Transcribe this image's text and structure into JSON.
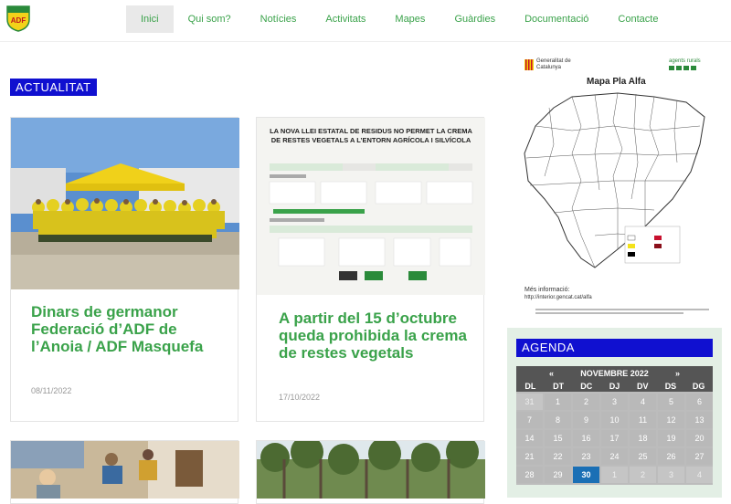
{
  "nav": {
    "items": [
      "Inici",
      "Qui som?",
      "Notícies",
      "Activitats",
      "Mapes",
      "Guàrdies",
      "Documentació",
      "Contacte"
    ],
    "active_index": 0
  },
  "logo": {
    "text": "ADF"
  },
  "section_label": "ACTUALITAT",
  "cards": [
    {
      "title": "Dinars de germanor Federació d’ADF de l’Anoia / ADF Masquefa",
      "date": "08/11/2022"
    },
    {
      "title": "A partir del 15 d’octubre queda prohibida la crema de restes vegetals",
      "date": "17/10/2022"
    }
  ],
  "notice": {
    "heading": "LA NOVA LLEI ESTATAL DE RESIDUS NO PERMET LA CREMA DE RESTES VEGETALS A L’ENTORN AGRÍCOLA I SILVÍCOLA"
  },
  "map": {
    "title": "Mapa Pla Alfa",
    "org_left": "Generalitat de Catalunya",
    "org_right": "agents rurals",
    "more_info": "Més informació:",
    "url": "http://interior.gencat.cat/alfa"
  },
  "agenda": {
    "label": "AGENDA",
    "prev": "«",
    "month": "NOVEMBRE 2022",
    "next": "»",
    "weekdays": [
      "DL",
      "DT",
      "DC",
      "DJ",
      "DV",
      "DS",
      "DG"
    ],
    "days": [
      "31",
      "1",
      "2",
      "3",
      "4",
      "5",
      "6",
      "7",
      "8",
      "9",
      "10",
      "11",
      "12",
      "13",
      "14",
      "15",
      "16",
      "17",
      "18",
      "19",
      "20",
      "21",
      "22",
      "23",
      "24",
      "25",
      "26",
      "27",
      "28",
      "29",
      "30",
      "1",
      "2",
      "3",
      "4"
    ],
    "today": "30"
  },
  "colors": {
    "accent": "#3aa24a",
    "label_bg": "#1010d0",
    "agenda_bg": "#e3efe5"
  }
}
